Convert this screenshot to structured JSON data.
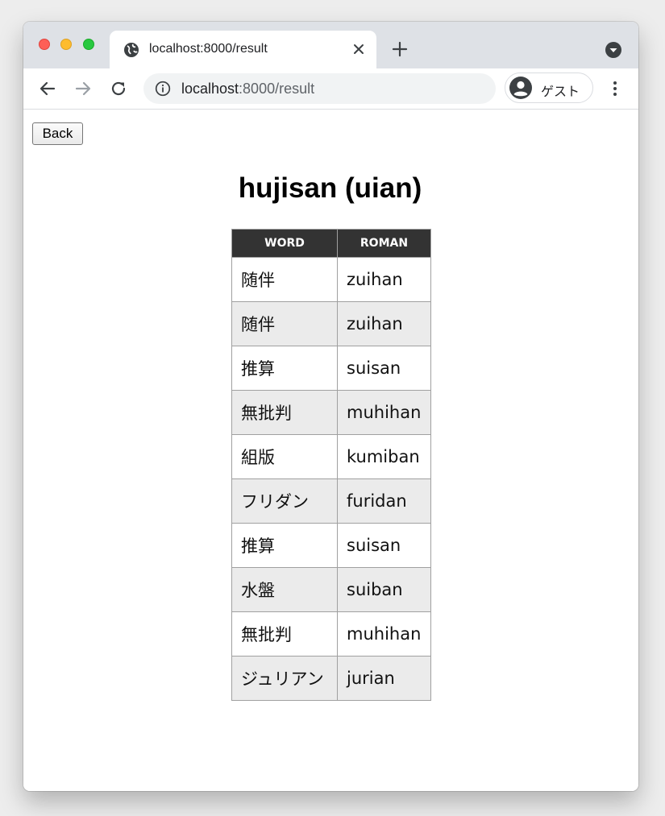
{
  "browser": {
    "tab_title": "localhost:8000/result",
    "url_host": "localhost",
    "url_path": ":8000/result",
    "profile_label": "ゲスト",
    "colors": {
      "chrome_frame": "#dee1e6",
      "omnibox": "#f1f3f4"
    }
  },
  "page": {
    "back_label": "Back",
    "title": "hujisan (uian)",
    "table": {
      "headers": [
        "WORD",
        "ROMAN"
      ],
      "rows": [
        {
          "word": "随伴",
          "roman": "zuihan"
        },
        {
          "word": "随伴",
          "roman": "zuihan"
        },
        {
          "word": "推算",
          "roman": "suisan"
        },
        {
          "word": "無批判",
          "roman": "muhihan"
        },
        {
          "word": "組版",
          "roman": "kumiban"
        },
        {
          "word": "フリダン",
          "roman": "furidan"
        },
        {
          "word": "推算",
          "roman": "suisan"
        },
        {
          "word": "水盤",
          "roman": "suiban"
        },
        {
          "word": "無批判",
          "roman": "muhihan"
        },
        {
          "word": "ジュリアン",
          "roman": "jurian"
        }
      ],
      "colors": {
        "header_bg": "#333333",
        "alt_row_bg": "#ebebeb"
      }
    }
  },
  "icons": {
    "tab_favicon": "globe-icon",
    "tab_close": "close-icon",
    "new_tab": "plus-icon",
    "tab_search": "chevron-down-circle-icon",
    "back": "arrow-left-icon",
    "forward": "arrow-right-icon",
    "reload": "reload-icon",
    "site_info": "info-icon",
    "profile": "user-avatar-icon",
    "menu": "kebab-menu-icon"
  }
}
